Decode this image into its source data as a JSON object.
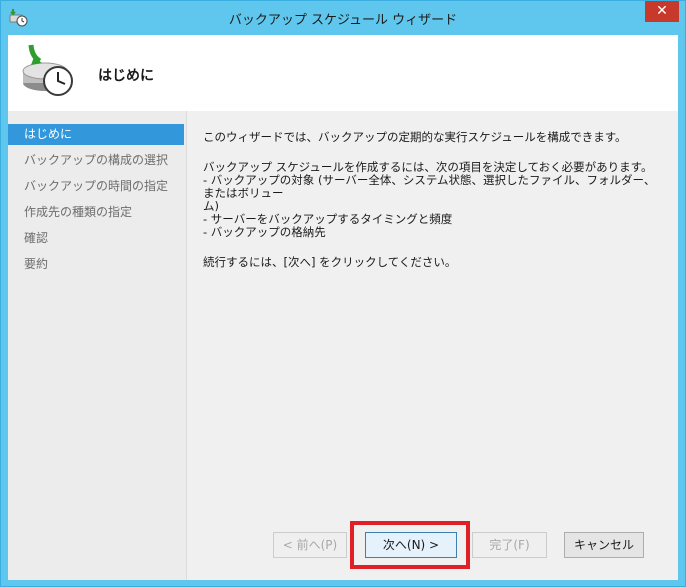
{
  "window": {
    "title": "バックアップ スケジュール ウィザード",
    "close_label": "✕"
  },
  "header": {
    "title": "はじめに"
  },
  "sidebar": {
    "items": [
      {
        "label": "はじめに",
        "active": true
      },
      {
        "label": "バックアップの構成の選択",
        "active": false
      },
      {
        "label": "バックアップの時間の指定",
        "active": false
      },
      {
        "label": "作成先の種類の指定",
        "active": false
      },
      {
        "label": "確認",
        "active": false
      },
      {
        "label": "要約",
        "active": false
      }
    ]
  },
  "content": {
    "intro": "このウィザードでは、バックアップの定期的な実行スケジュールを構成できます。",
    "requirements_heading": "バックアップ スケジュールを作成するには、次の項目を決定しておく必要があります。",
    "requirement_1_line1": "-  バックアップの対象 (サーバー全体、システム状態、選択したファイル、フォルダー、またはボリュー",
    "requirement_1_line2": "ム)",
    "requirement_2": "-  サーバーをバックアップするタイミングと頻度",
    "requirement_3": "-  バックアップの格納先",
    "continue": "続行するには、[次へ] をクリックしてください。"
  },
  "buttons": {
    "back": "< 前へ(P)",
    "next": "次へ(N) >",
    "finish": "完了(F)",
    "cancel": "キャンセル"
  },
  "colors": {
    "titlebar": "#5fc7ee",
    "selected": "#3398db",
    "highlight": "#e01f26"
  }
}
